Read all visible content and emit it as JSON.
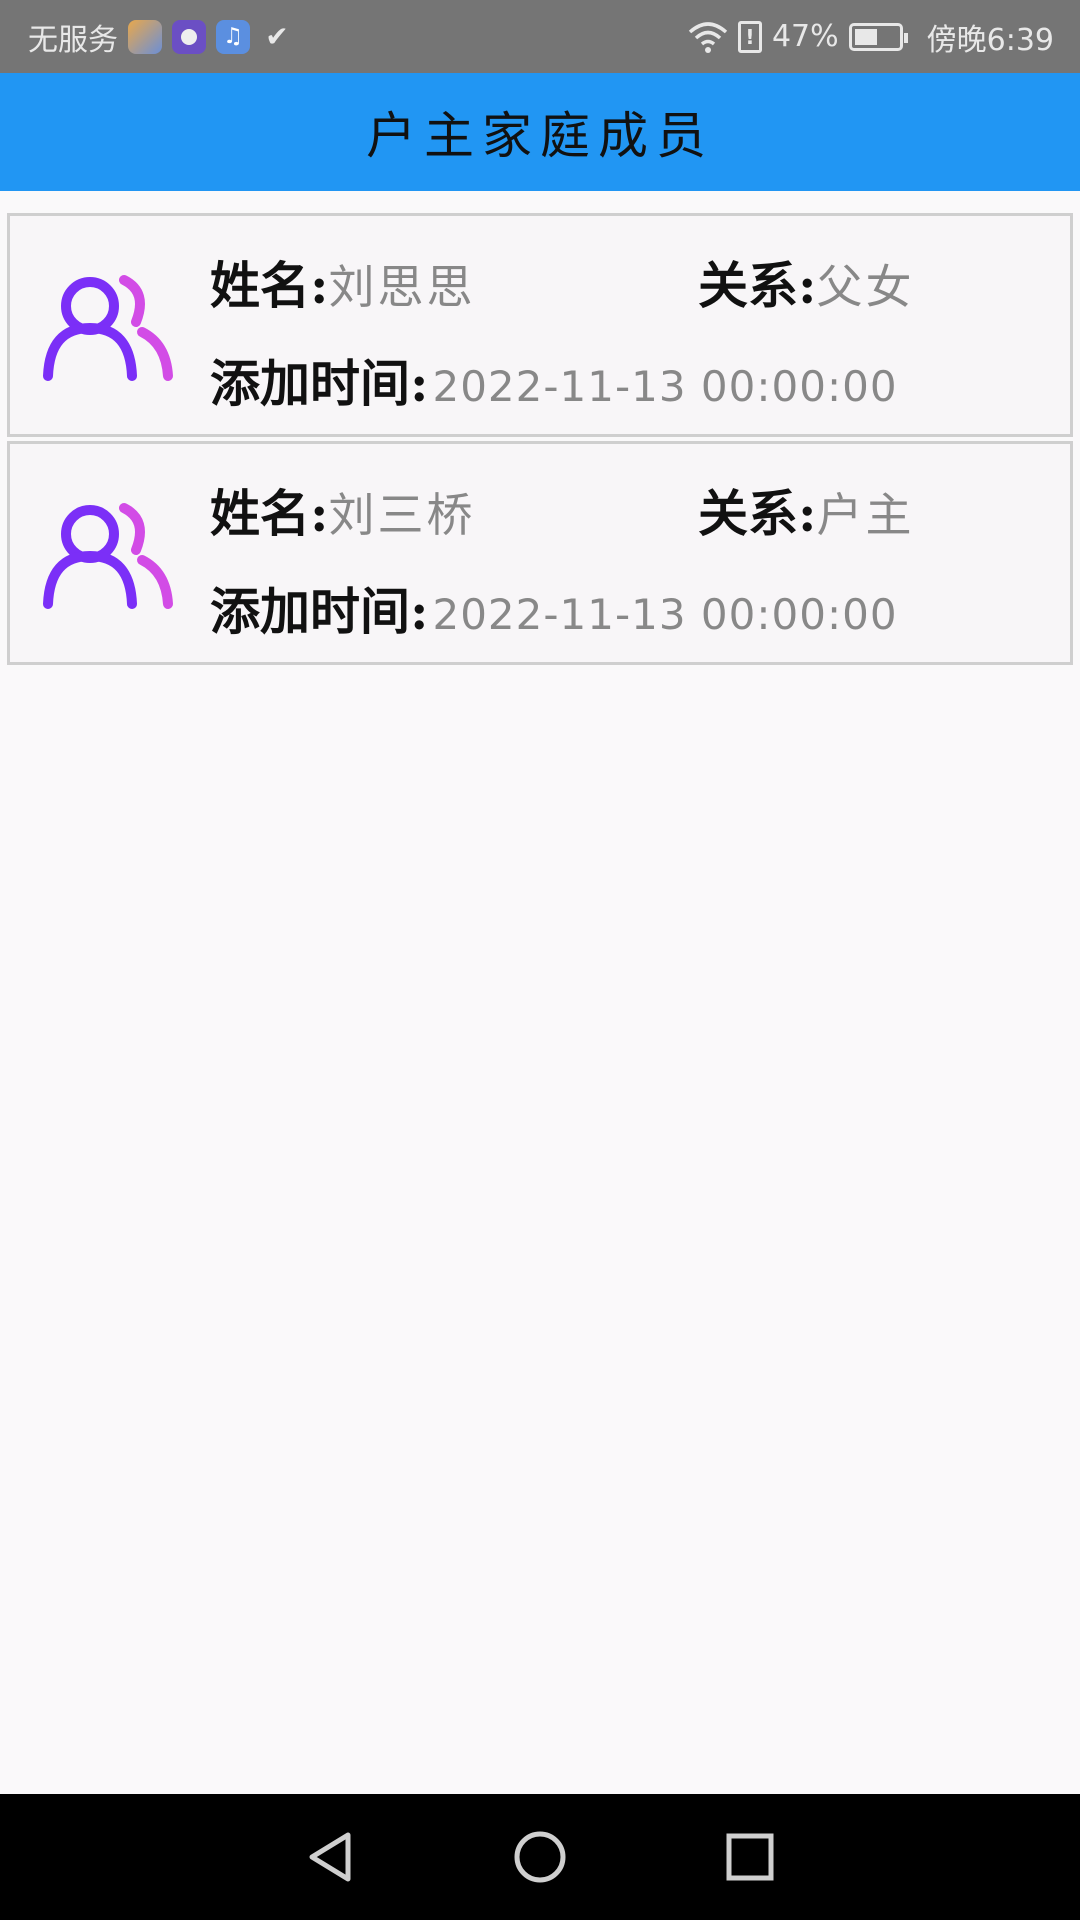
{
  "status_bar": {
    "carrier": "无服务",
    "battery_percent": "47%",
    "time": "傍晚6:39",
    "icons": [
      "game-app-icon",
      "purple-app-icon",
      "music-app-icon",
      "check-app-icon",
      "wifi-icon",
      "sim-alert-icon",
      "battery-icon"
    ]
  },
  "header": {
    "title": "户主家庭成员"
  },
  "labels": {
    "name": "姓名:",
    "relation": "关系:",
    "added_time": "添加时间:"
  },
  "members": [
    {
      "name": "刘思思",
      "relation": "父女",
      "added_time": "2022-11-13  00:00:00"
    },
    {
      "name": "刘三桥",
      "relation": "户主",
      "added_time": "2022-11-13  00:00:00"
    }
  ],
  "colors": {
    "appbar": "#2196f3",
    "avatar_primary": "#7b2ff7",
    "avatar_secondary": "#d24ce6"
  },
  "nav": {
    "icons": [
      "back-icon",
      "home-icon",
      "recents-icon"
    ]
  }
}
